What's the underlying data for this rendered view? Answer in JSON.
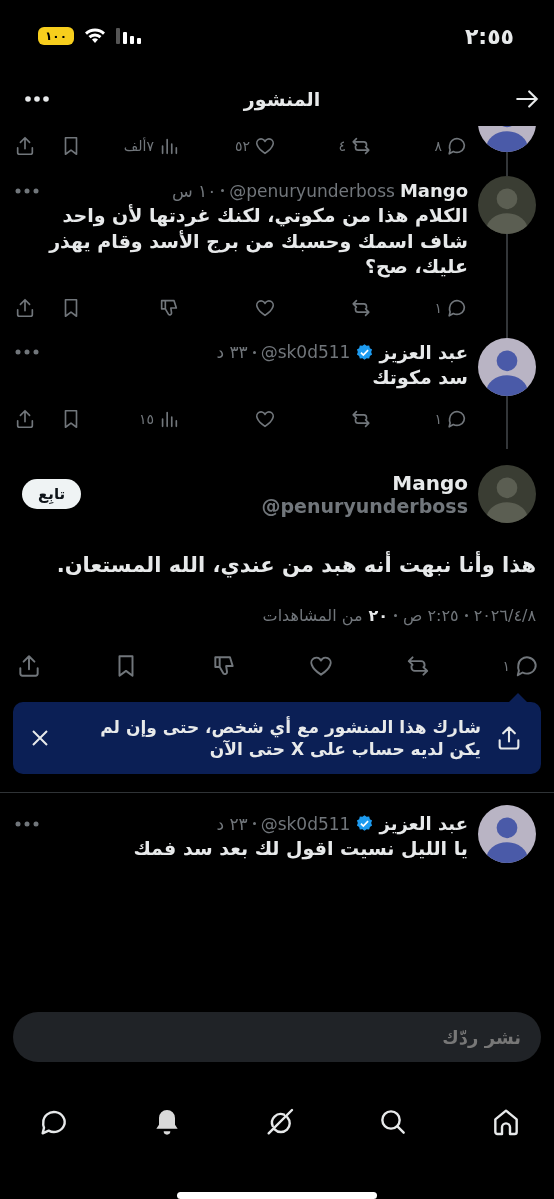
{
  "status_bar": {
    "time": "٢:٥٥",
    "battery": "١٠٠"
  },
  "header": {
    "title": "المنشور"
  },
  "top_tweet": {
    "actions": [
      {
        "kind": "reply",
        "count": "٨"
      },
      {
        "kind": "retweet",
        "count": "٤"
      },
      {
        "kind": "like",
        "count": "٥٢"
      },
      {
        "kind": "views",
        "count": "٧ألف"
      },
      {
        "kind": "bookmark"
      },
      {
        "kind": "share"
      }
    ]
  },
  "replies_above": [
    {
      "name": "Mango",
      "verified": false,
      "handle": "@penuryunderboss",
      "time": "١٠ س",
      "text": "الكلام هذا من مكوتي، لكنك غردتها لأن واحد شاف اسمك وحسبك من برج الأسد وقام يهذر عليك، صح؟",
      "actions": [
        {
          "kind": "reply",
          "count": "١"
        },
        {
          "kind": "retweet"
        },
        {
          "kind": "like"
        },
        {
          "kind": "dislike"
        },
        {
          "kind": "bookmark"
        },
        {
          "kind": "share"
        }
      ]
    },
    {
      "name": "عبد العزيز",
      "verified": true,
      "handle": "@sk0d511",
      "time": "٣٣ د",
      "text": "سد مكوتك",
      "actions": [
        {
          "kind": "reply",
          "count": "١"
        },
        {
          "kind": "retweet"
        },
        {
          "kind": "like"
        },
        {
          "kind": "views",
          "count": "١٥"
        },
        {
          "kind": "bookmark"
        },
        {
          "kind": "share"
        }
      ]
    }
  ],
  "main_tweet": {
    "name": "Mango",
    "handle": "@penuryunderboss",
    "follow_button": "تابِع",
    "text": "هذا وأنا نبهت أنه هبد من عندي، الله المستعان.",
    "date": "٢٠٢٦/٤/٨",
    "time": "٢:٢٥ ص",
    "views": "٢٠",
    "views_label": "من المشاهدات",
    "actions": [
      {
        "kind": "reply",
        "count": "١"
      },
      {
        "kind": "retweet"
      },
      {
        "kind": "like"
      },
      {
        "kind": "dislike"
      },
      {
        "kind": "bookmark"
      },
      {
        "kind": "share"
      }
    ]
  },
  "share_tip": {
    "text": "شارك هذا المنشور مع أي شخص، حتى وإن لم يكن لديه حساب على X حتى الآن"
  },
  "replies_below": [
    {
      "name": "عبد العزيز",
      "verified": true,
      "handle": "@sk0d511",
      "time": "٢٣ د",
      "text": "يا الليل نسيت اقول لك بعد سد فمك"
    }
  ],
  "reply_field": {
    "placeholder": "نشر ردّك"
  },
  "nav": [
    {
      "kind": "home"
    },
    {
      "kind": "search"
    },
    {
      "kind": "grok"
    },
    {
      "kind": "bell"
    },
    {
      "kind": "messages"
    }
  ]
}
